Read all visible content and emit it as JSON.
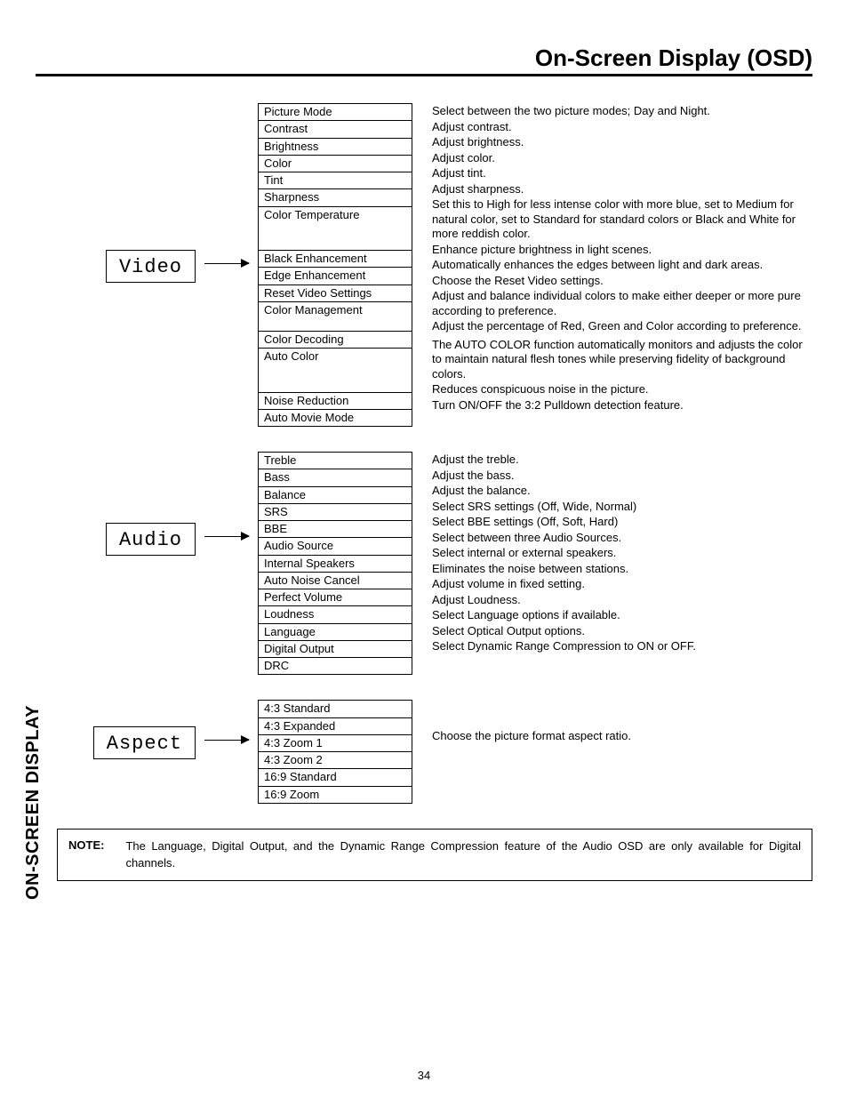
{
  "title": "On-Screen Display (OSD)",
  "side_tab": "ON-SCREEN DISPLAY",
  "page_number": "34",
  "note_label": "NOTE:",
  "note_text": "The Language, Digital Output, and the Dynamic Range Compression feature of the Audio OSD are only available for Digital channels.",
  "sections": {
    "video": {
      "label": "Video",
      "items": [
        {
          "name": "Picture Mode",
          "desc": "Select between the two picture modes; Day and Night."
        },
        {
          "name": "Contrast",
          "desc": "Adjust contrast."
        },
        {
          "name": "Brightness",
          "desc": "Adjust brightness."
        },
        {
          "name": "Color",
          "desc": "Adjust color."
        },
        {
          "name": "Tint",
          "desc": "Adjust tint."
        },
        {
          "name": "Sharpness",
          "desc": "Adjust sharpness."
        },
        {
          "name": "Color Temperature",
          "desc": "Set this to High for less intense color with more blue, set to Medium for natural color, set to Standard for standard colors or Black and White for more reddish color.",
          "rows": 3
        },
        {
          "name": "Black Enhancement",
          "desc": "Enhance picture brightness in light scenes."
        },
        {
          "name": "Edge Enhancement",
          "desc": "Automatically enhances the edges between light and dark areas."
        },
        {
          "name": "Reset Video Settings",
          "desc": "Choose the Reset Video settings."
        },
        {
          "name": "Color Management",
          "desc": "Adjust and balance individual colors to make either deeper or more pure according to preference.",
          "rows": 2
        },
        {
          "name": "Color Decoding",
          "desc": "Adjust the percentage of Red, Green and Color according to preference."
        },
        {
          "name": "Auto Color",
          "desc": "The AUTO COLOR function automatically monitors and adjusts the color to maintain natural flesh tones while preserving fidelity of background colors.",
          "rows": 3,
          "pad_top": 4
        },
        {
          "name": "Noise Reduction",
          "desc": "Reduces conspicuous noise in the picture."
        },
        {
          "name": "Auto Movie Mode",
          "desc": "Turn ON/OFF the 3:2 Pulldown detection feature."
        }
      ]
    },
    "audio": {
      "label": "Audio",
      "items": [
        {
          "name": "Treble",
          "desc": "Adjust the treble."
        },
        {
          "name": "Bass",
          "desc": "Adjust the bass."
        },
        {
          "name": "Balance",
          "desc": "Adjust the balance."
        },
        {
          "name": "SRS",
          "desc": "Select SRS settings (Off, Wide, Normal)"
        },
        {
          "name": "BBE",
          "desc": "Select BBE settings (Off, Soft, Hard)"
        },
        {
          "name": "Audio Source",
          "desc": "Select between three Audio Sources."
        },
        {
          "name": "Internal Speakers",
          "desc": "Select internal or external speakers."
        },
        {
          "name": "Auto Noise Cancel",
          "desc": "Eliminates the noise between stations."
        },
        {
          "name": "Perfect Volume",
          "desc": "Adjust volume in fixed setting."
        },
        {
          "name": "Loudness",
          "desc": "Adjust Loudness."
        },
        {
          "name": "Language",
          "desc": "Select Language options if available."
        },
        {
          "name": "Digital Output",
          "desc": "Select Optical Output options."
        },
        {
          "name": "DRC",
          "desc": "Select Dynamic Range Compression to ON or OFF."
        }
      ]
    },
    "aspect": {
      "label": "Aspect",
      "desc": "Choose the picture format aspect ratio.",
      "items": [
        {
          "name": "4:3 Standard"
        },
        {
          "name": "4:3 Expanded"
        },
        {
          "name": "4:3 Zoom 1"
        },
        {
          "name": "4:3 Zoom 2"
        },
        {
          "name": "16:9 Standard"
        },
        {
          "name": "16:9 Zoom"
        }
      ]
    }
  }
}
